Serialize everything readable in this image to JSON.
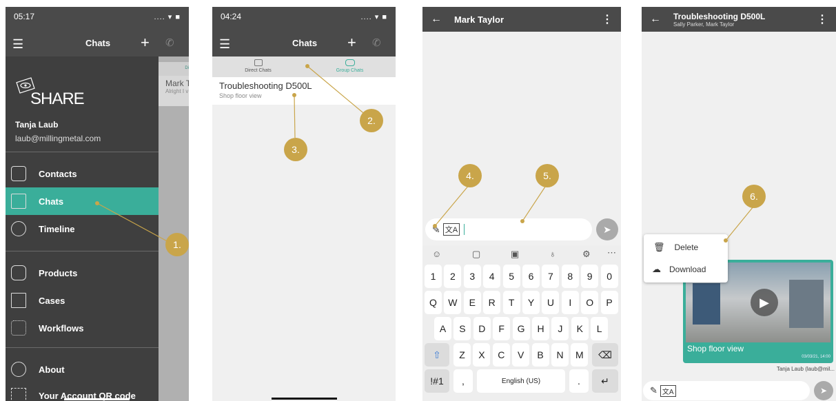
{
  "phone1": {
    "time": "05:17",
    "status_icons": ".... ▾ ■",
    "title": "Chats",
    "logo": "SHARE",
    "user_name": "Tanja Laub",
    "user_email": "laub@millingmetal.com",
    "menu": [
      {
        "label": "Contacts",
        "icon": "contacts-icon"
      },
      {
        "label": "Chats",
        "icon": "chat-icon"
      },
      {
        "label": "Timeline",
        "icon": "clock-icon"
      },
      {
        "label": "Products",
        "icon": "product-icon"
      },
      {
        "label": "Cases",
        "icon": "case-icon"
      },
      {
        "label": "Workflows",
        "icon": "workflow-icon"
      },
      {
        "label": "About",
        "icon": "info-icon"
      },
      {
        "label": "Your Account QR code",
        "icon": "qr-icon"
      }
    ],
    "behind_tab": "Di",
    "behind_name": "Mark Ta",
    "behind_preview": "Alright I v",
    "marker": "1."
  },
  "phone2": {
    "time": "04:24",
    "status_icons": ".... ▾ ■",
    "title": "Chats",
    "tabs": [
      "Direct Chats",
      "Group Chats"
    ],
    "chat_title": "Troubleshooting D500L",
    "chat_subtitle": "Shop floor view",
    "markers": [
      "2.",
      "3."
    ]
  },
  "phone3": {
    "title": "Mark Taylor",
    "markers": [
      "4.",
      "5."
    ],
    "keyboard": {
      "row1": [
        "1",
        "2",
        "3",
        "4",
        "5",
        "6",
        "7",
        "8",
        "9",
        "0"
      ],
      "row2": [
        "Q",
        "W",
        "E",
        "R",
        "T",
        "Y",
        "U",
        "I",
        "O",
        "P"
      ],
      "row3": [
        "A",
        "S",
        "D",
        "F",
        "G",
        "H",
        "J",
        "K",
        "L"
      ],
      "row4": [
        "Z",
        "X",
        "C",
        "V",
        "B",
        "N",
        "M"
      ],
      "sym": "!#1",
      "comma": ",",
      "space": "English (US)",
      "period": "."
    }
  },
  "phone4": {
    "title": "Troubleshooting D500L",
    "subtitle": "Sally Parker, Mark Taylor",
    "marker": "6.",
    "menu": [
      "Delete",
      "Download"
    ],
    "video_caption": "Shop floor view",
    "video_time": "03/03/21, 14:00",
    "sender": "Tanja Laub (laub@mil..."
  },
  "colors": {
    "dark": "#4a4a4a",
    "accent": "#3aae9a",
    "marker": "#c9a54a"
  }
}
